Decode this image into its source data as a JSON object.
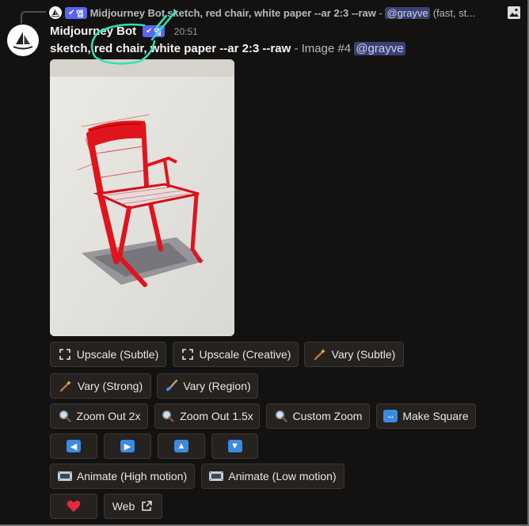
{
  "reply": {
    "author": "Midjourney Bot",
    "app_badge": "앱",
    "content": "sketch, red chair, white paper --ar 2:3 --raw",
    "separator": " - ",
    "mention": "@grayve",
    "tail": "(fast, st..."
  },
  "message": {
    "author": "Midjourney Bot",
    "app_badge": "앱",
    "timestamp": "20:51",
    "prompt": "sketch, red chair, white paper --ar 2:3 --raw",
    "image_label": " - Image #4 ",
    "mention": "@grayve"
  },
  "buttons": {
    "upscale_subtle": "Upscale (Subtle)",
    "upscale_creative": "Upscale (Creative)",
    "vary_subtle": "Vary (Subtle)",
    "vary_strong": "Vary (Strong)",
    "vary_region": "Vary (Region)",
    "zoom_out_2x": "Zoom Out 2x",
    "zoom_out_1_5x": "Zoom Out 1.5x",
    "custom_zoom": "Custom Zoom",
    "make_square": "Make Square",
    "animate_high": "Animate (High motion)",
    "animate_low": "Animate (Low motion)",
    "web": "Web"
  },
  "icons": {
    "upscale": "expand-corners-icon",
    "vary": "magic-wand-icon",
    "region": "paintbrush-icon",
    "zoom": "magnifier-icon",
    "make_square": "left-right-arrow-icon",
    "pan_left": "left-arrow-icon",
    "pan_right": "right-arrow-icon",
    "pan_up": "up-arrow-icon",
    "pan_down": "down-arrow-icon",
    "animate": "film-strip-icon",
    "favorite": "heart-icon",
    "external": "external-link-icon"
  },
  "colors": {
    "background": "#141210",
    "button_bg": "#25221f",
    "mention_bg": "#3c4270",
    "app_badge": "#5865f2",
    "arrow_blue": "#3d8be0",
    "heart": "#e8283c",
    "annotation": "#2fe3b5"
  }
}
